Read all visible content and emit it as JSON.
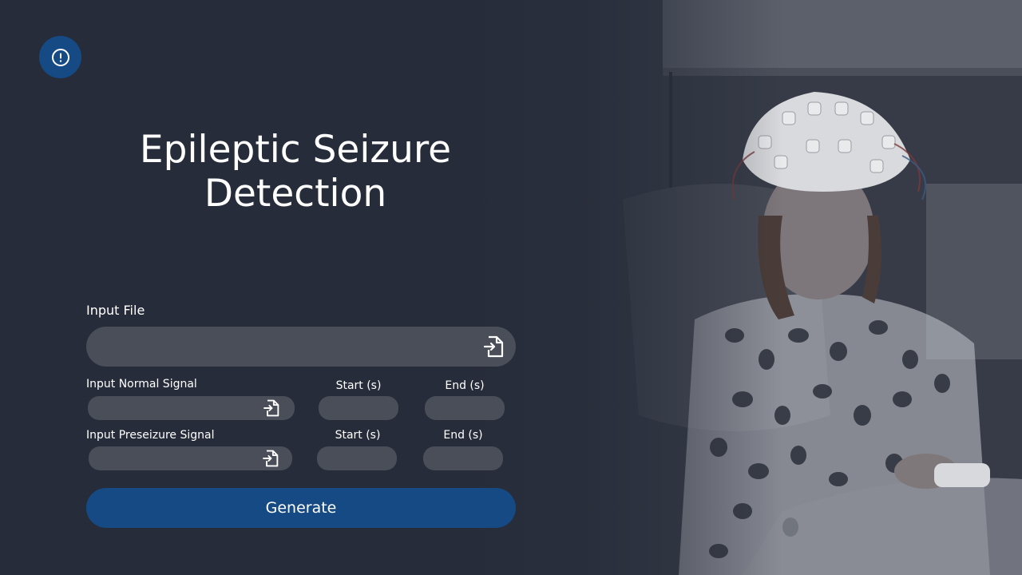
{
  "app": {
    "title_line1": "Epileptic Seizure",
    "title_line2": "Detection"
  },
  "info_button": {
    "icon": "info-circle-icon"
  },
  "input_file": {
    "label": "Input File",
    "value": "",
    "icon": "file-import-icon"
  },
  "normal_signal": {
    "label": "Input Normal Signal",
    "value": "",
    "icon": "file-import-icon",
    "start_label": "Start (s)",
    "start_value": "",
    "end_label": "End (s)",
    "end_value": ""
  },
  "preseizure_signal": {
    "label": "Input Preseizure Signal",
    "value": "",
    "icon": "file-import-icon",
    "start_label": "Start (s)",
    "start_value": "",
    "end_label": "End (s)",
    "end_value": ""
  },
  "generate_button": {
    "label": "Generate"
  },
  "colors": {
    "background": "#272c3a",
    "accent": "#154a85",
    "field": "#4a4e58",
    "text": "#ffffff"
  }
}
